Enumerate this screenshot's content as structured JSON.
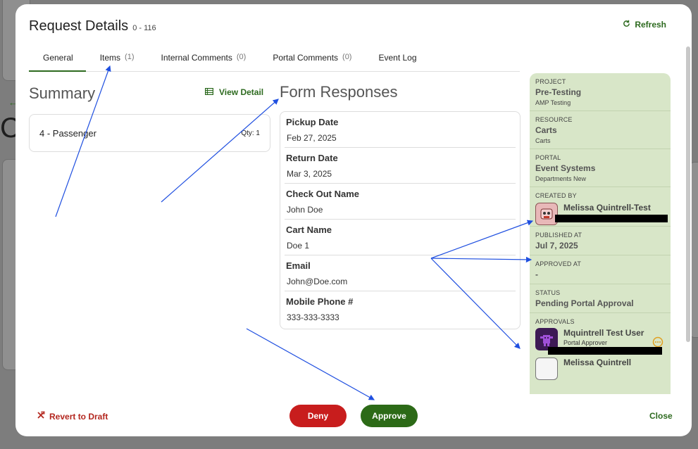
{
  "modal": {
    "title": "Request Details",
    "request_id": "0 - 116",
    "refresh_label": "Refresh"
  },
  "tabs": [
    {
      "label": "General",
      "count": ""
    },
    {
      "label": "Items",
      "count": "(1)"
    },
    {
      "label": "Internal Comments",
      "count": "(0)"
    },
    {
      "label": "Portal Comments",
      "count": "(0)"
    },
    {
      "label": "Event Log",
      "count": ""
    }
  ],
  "summary": {
    "heading": "Summary",
    "view_detail_label": "View Detail",
    "item_name": "4 - Passenger",
    "item_qty": "Qty: 1"
  },
  "form": {
    "heading": "Form Responses",
    "fields": [
      {
        "label": "Pickup Date",
        "value": "Feb 27, 2025"
      },
      {
        "label": "Return Date",
        "value": "Mar 3, 2025"
      },
      {
        "label": "Check Out Name",
        "value": "John Doe"
      },
      {
        "label": "Cart Name",
        "value": "Doe 1"
      },
      {
        "label": "Email",
        "value": "John@Doe.com"
      },
      {
        "label": "Mobile Phone #",
        "value": "333-333-3333"
      }
    ]
  },
  "sidebar": {
    "project": {
      "label": "PROJECT",
      "value": "Pre-Testing",
      "sub": "AMP Testing"
    },
    "resource": {
      "label": "RESOURCE",
      "value": "Carts",
      "sub": "Carts"
    },
    "portal": {
      "label": "PORTAL",
      "value": "Event Systems",
      "sub": "Departments New"
    },
    "created_by": {
      "label": "CREATED BY",
      "name": "Melissa Quintrell-Test"
    },
    "published_at": {
      "label": "PUBLISHED AT",
      "value": "Jul 7, 2025"
    },
    "approved_at": {
      "label": "APPROVED AT",
      "value": "-"
    },
    "status": {
      "label": "STATUS",
      "value": "Pending Portal Approval"
    },
    "approvals": {
      "label": "APPROVALS",
      "first_name": "Mquintrell Test User",
      "first_role": "Portal Approver",
      "second_name": "Melissa Quintrell"
    }
  },
  "footer": {
    "revert_label": "Revert to Draft",
    "deny_label": "Deny",
    "approve_label": "Approve",
    "close_label": "Close"
  },
  "colors": {
    "accent_green": "#2d6a1f",
    "deny_red": "#c81d1d",
    "sidebar_bg": "#d8e6c8",
    "annotation_blue": "#1f4fe0"
  }
}
